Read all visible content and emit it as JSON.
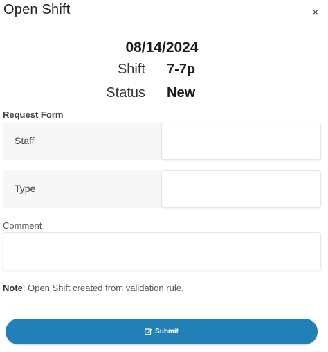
{
  "dialog": {
    "title": "Open Shift",
    "close_glyph": "×"
  },
  "shift": {
    "date": "08/14/2024",
    "shift_label": "Shift",
    "shift_value": "7-7p",
    "status_label": "Status",
    "status_value": "New"
  },
  "form": {
    "section_title": "Request Form",
    "staff_label": "Staff",
    "staff_value": "",
    "type_label": "Type",
    "type_value": "",
    "comment_label": "Comment",
    "comment_value": ""
  },
  "note": {
    "prefix": "Note",
    "text": ": Open Shift created from validation rule."
  },
  "submit": {
    "label": "Submit",
    "icon": "edit-icon",
    "color": "#2180b8"
  }
}
